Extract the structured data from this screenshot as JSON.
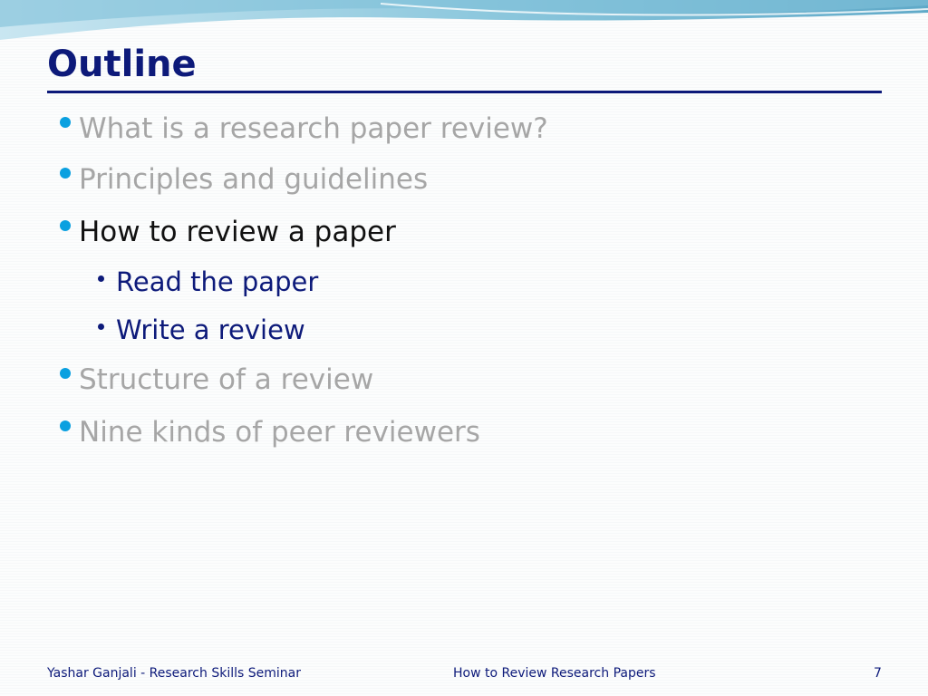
{
  "slide": {
    "title": "Outline",
    "bullets": [
      {
        "text": "What is a research paper review?",
        "state": "dimmed"
      },
      {
        "text": "Principles and guidelines",
        "state": "dimmed"
      },
      {
        "text": "How to review a paper",
        "state": "active"
      },
      {
        "text": "Read the paper",
        "state": "sub"
      },
      {
        "text": "Write a review",
        "state": "sub"
      },
      {
        "text": "Structure of a review",
        "state": "dimmed"
      },
      {
        "text": "Nine kinds of peer reviewers",
        "state": "dimmed"
      }
    ]
  },
  "footer": {
    "author": "Yashar Ganjali - Research Skills Seminar",
    "deck_title": "How to Review Research Papers",
    "page_number": "7"
  },
  "colors": {
    "title": "#0d1a7a",
    "bullet_dot": "#0aa0e0",
    "dimmed_text": "#a6a6a6",
    "active_text": "#111111",
    "sub_text": "#0d1a7a"
  }
}
